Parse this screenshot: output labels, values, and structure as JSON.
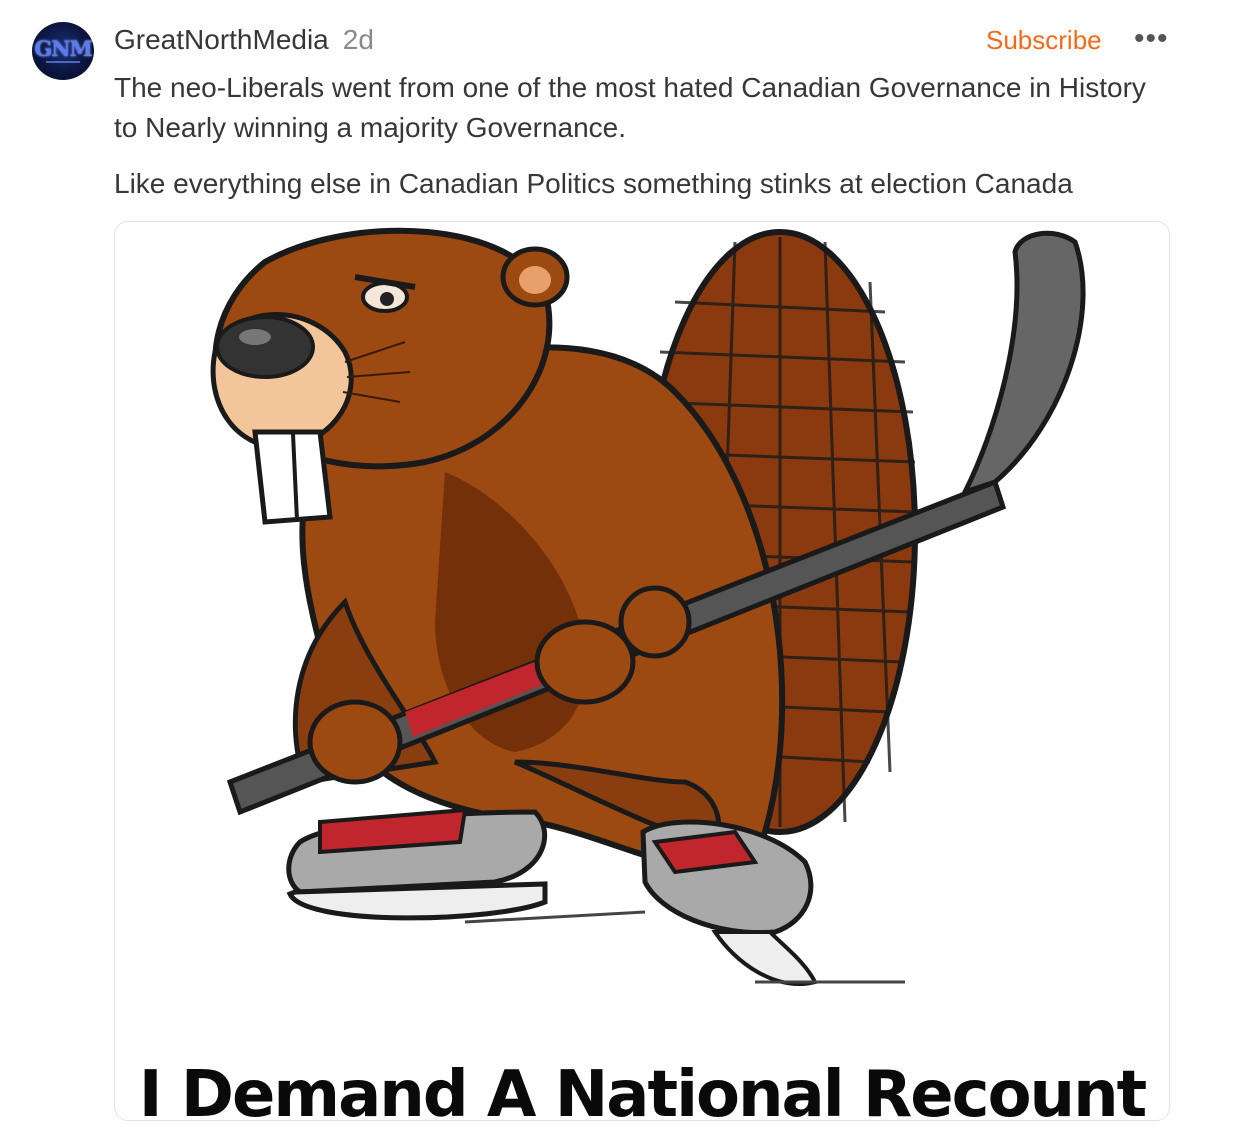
{
  "post": {
    "avatar_text": "GNM",
    "publication_name": "GreatNorthMedia",
    "timestamp": "2d",
    "subscribe_label": "Subscribe",
    "more_label": "•••",
    "paragraphs": [
      "The neo-Liberals went from one of the most hated Canadian Governance in History to Nearly winning a majority Governance.",
      "Like everything else in Canadian Politics something stinks at election Canada"
    ],
    "image": {
      "caption": "I Demand A National Recount"
    }
  },
  "colors": {
    "accent": "#f26a1b",
    "text": "#363737",
    "muted": "#8a8a8a"
  }
}
